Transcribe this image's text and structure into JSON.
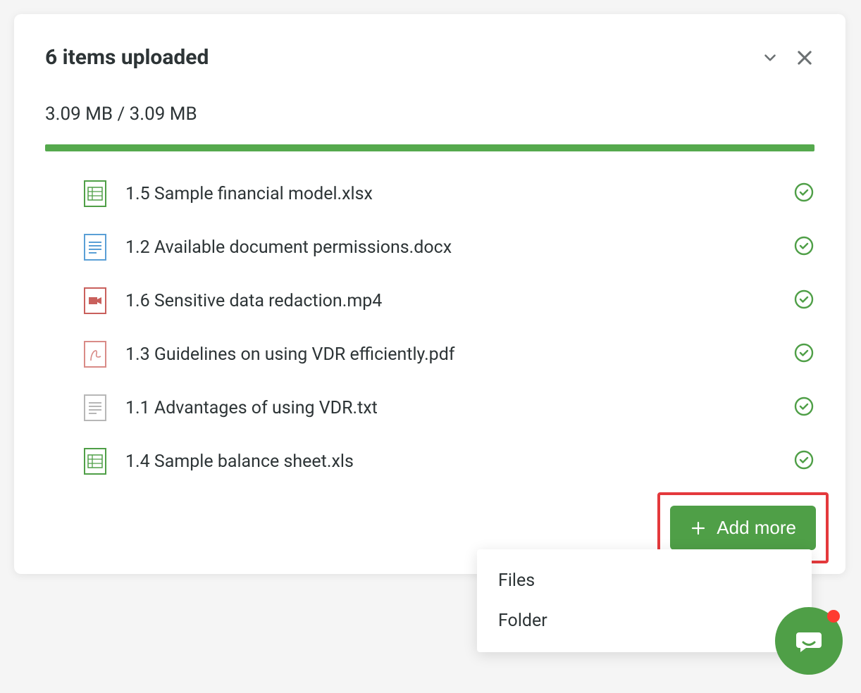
{
  "header": {
    "title": "6 items uploaded"
  },
  "progress": {
    "text": "3.09 MB / 3.09 MB"
  },
  "files": [
    {
      "name": "1.5 Sample financial model.xlsx",
      "type": "xlsx"
    },
    {
      "name": "1.2 Available document permissions.docx",
      "type": "docx"
    },
    {
      "name": "1.6 Sensitive data redaction.mp4",
      "type": "mp4"
    },
    {
      "name": "1.3 Guidelines on using VDR efficiently.pdf",
      "type": "pdf"
    },
    {
      "name": "1.1 Advantages of using VDR.txt",
      "type": "txt"
    },
    {
      "name": "1.4 Sample balance sheet.xls",
      "type": "xls"
    }
  ],
  "addMore": {
    "label": "Add more",
    "menu": {
      "files": "Files",
      "folder": "Folder"
    }
  },
  "colors": {
    "primary": "#4f9f47",
    "highlight": "#e4393c",
    "text": "#2d3436"
  }
}
